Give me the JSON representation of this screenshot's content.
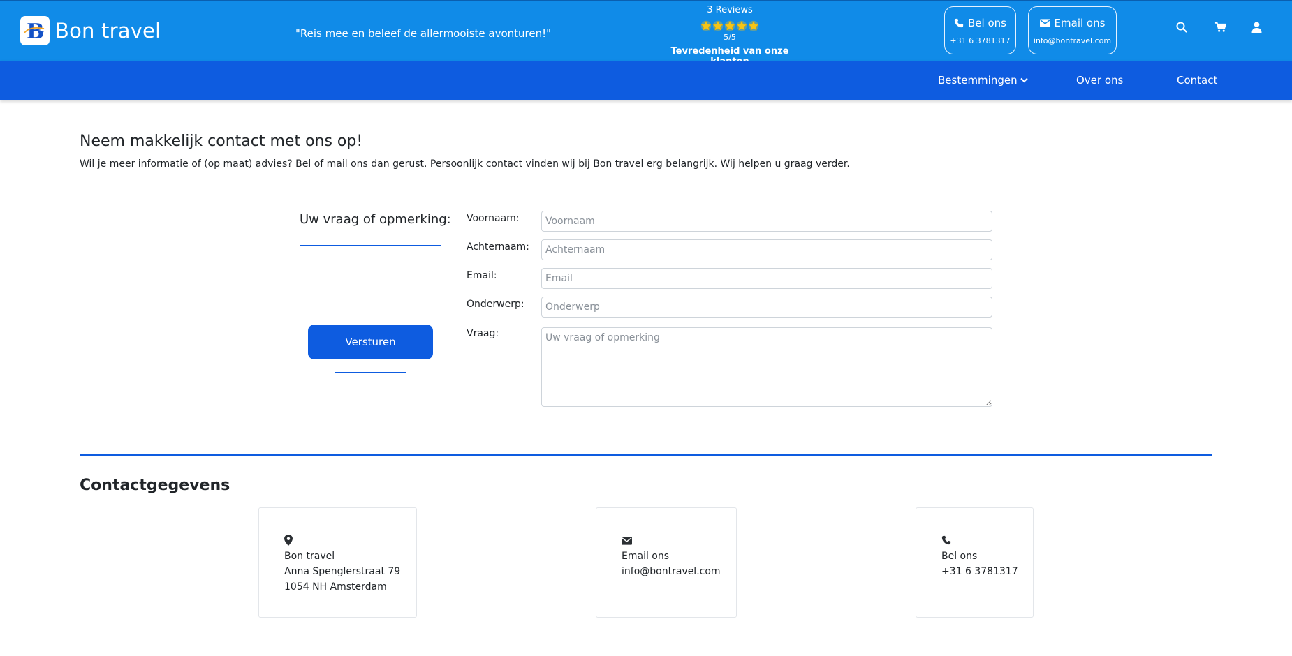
{
  "header": {
    "brand": "Bon travel",
    "tagline": "\"Reis mee en beleef de allermooiste avonturen!\"",
    "reviews": {
      "count_label": "3 Reviews",
      "rating": 5,
      "max_rating": 5,
      "score_label": "5/5",
      "caption": "Tevredenheid van onze klanten",
      "star_color": "#f5c518"
    },
    "call": {
      "label": "Bel ons",
      "value": "+31 6 3781317",
      "icon": "phone-icon"
    },
    "mail": {
      "label": "Email ons",
      "value": "info@bontravel.com",
      "icon": "envelope-icon"
    },
    "icons": [
      "search-icon",
      "cart-icon",
      "user-icon"
    ]
  },
  "nav": {
    "items": [
      {
        "label": "Bestemmingen",
        "has_dropdown": true
      },
      {
        "label": "Over ons"
      },
      {
        "label": "Contact"
      }
    ]
  },
  "intro": {
    "title": "Neem makkelijk contact met ons op!",
    "text": "Wil je meer informatie of (op maat) advies? Bel of mail ons dan gerust. Persoonlijk contact vinden wij bij Bon travel erg belangrijk. Wij helpen u graag verder."
  },
  "form": {
    "heading": "Uw vraag of opmerking:",
    "submit_label": "Versturen",
    "fields": {
      "first_name": {
        "label": "Voornaam:",
        "placeholder": "Voornaam",
        "value": ""
      },
      "last_name": {
        "label": "Achternaam:",
        "placeholder": "Achternaam",
        "value": ""
      },
      "email": {
        "label": "Email:",
        "placeholder": "Email",
        "value": ""
      },
      "subject": {
        "label": "Onderwerp:",
        "placeholder": "Onderwerp",
        "value": ""
      },
      "question": {
        "label": "Vraag:",
        "placeholder": "Uw vraag of opmerking",
        "value": ""
      }
    }
  },
  "details": {
    "title": "Contactgegevens",
    "cards": [
      {
        "icon": "map-pin-icon",
        "name": "Bon travel",
        "lines": [
          "Anna Spenglerstraat 79",
          "1054 NH Amsterdam"
        ]
      },
      {
        "icon": "envelope-icon",
        "name": "Email ons",
        "lines": [
          "info@bontravel.com"
        ]
      },
      {
        "icon": "phone-icon",
        "name": "Bel ons",
        "lines": [
          "+31 6 3781317"
        ]
      }
    ]
  },
  "colors": {
    "header_bg": "#108be8",
    "nav_bg": "#0e5ce0",
    "accent": "#0e5ce0",
    "text": "#212529"
  }
}
